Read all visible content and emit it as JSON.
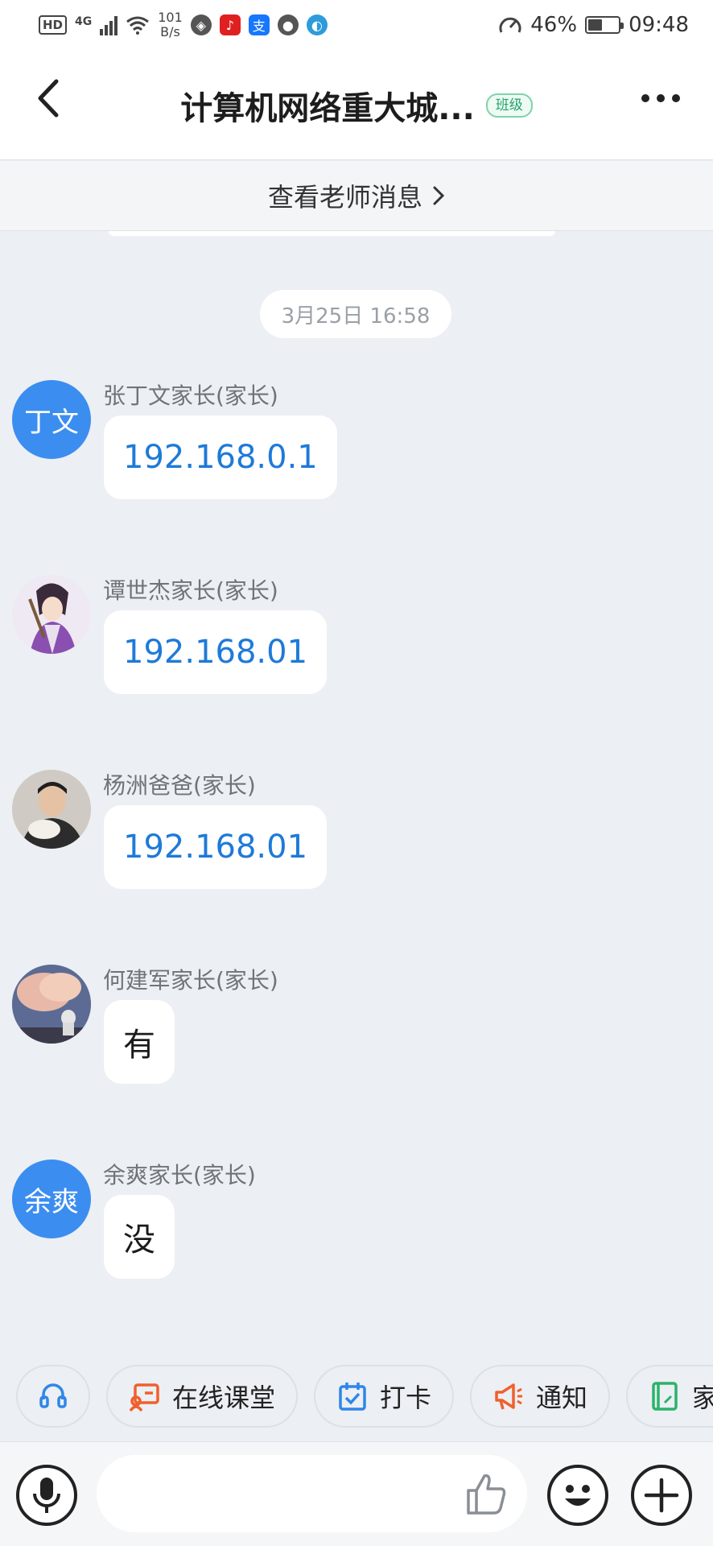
{
  "status_bar": {
    "hd": "HD",
    "network": "4G",
    "speed_value": "101",
    "speed_unit": "B/s",
    "battery": "46%",
    "time": "09:48"
  },
  "header": {
    "title": "计算机网络重大城...",
    "badge": "班级"
  },
  "teacher_bar": {
    "label": "查看老师消息"
  },
  "timestamp": "3月25日 16:58",
  "messages": [
    {
      "sender": "张丁文家长(家长)",
      "avatar_text": "丁文",
      "text": "192.168.0.1",
      "is_link": true
    },
    {
      "sender": "谭世杰家长(家长)",
      "avatar_text": "",
      "text": "192.168.01",
      "is_link": true
    },
    {
      "sender": "杨洲爸爸(家长)",
      "avatar_text": "",
      "text": "192.168.01",
      "is_link": true
    },
    {
      "sender": "何建军家长(家长)",
      "avatar_text": "",
      "text": "有",
      "is_link": false
    },
    {
      "sender": "余爽家长(家长)",
      "avatar_text": "余爽",
      "text": "没",
      "is_link": false
    }
  ],
  "quick_actions": {
    "online_class": "在线课堂",
    "checkin": "打卡",
    "notice": "通知",
    "homework": "家校"
  },
  "input": {
    "placeholder": ""
  },
  "colors": {
    "accent": "#3b8df0",
    "link": "#1e7ad8",
    "badge_green": "#22a46b",
    "chip_orange": "#f0602c",
    "chip_blue": "#2f86e8",
    "chip_green": "#2bb36b"
  }
}
